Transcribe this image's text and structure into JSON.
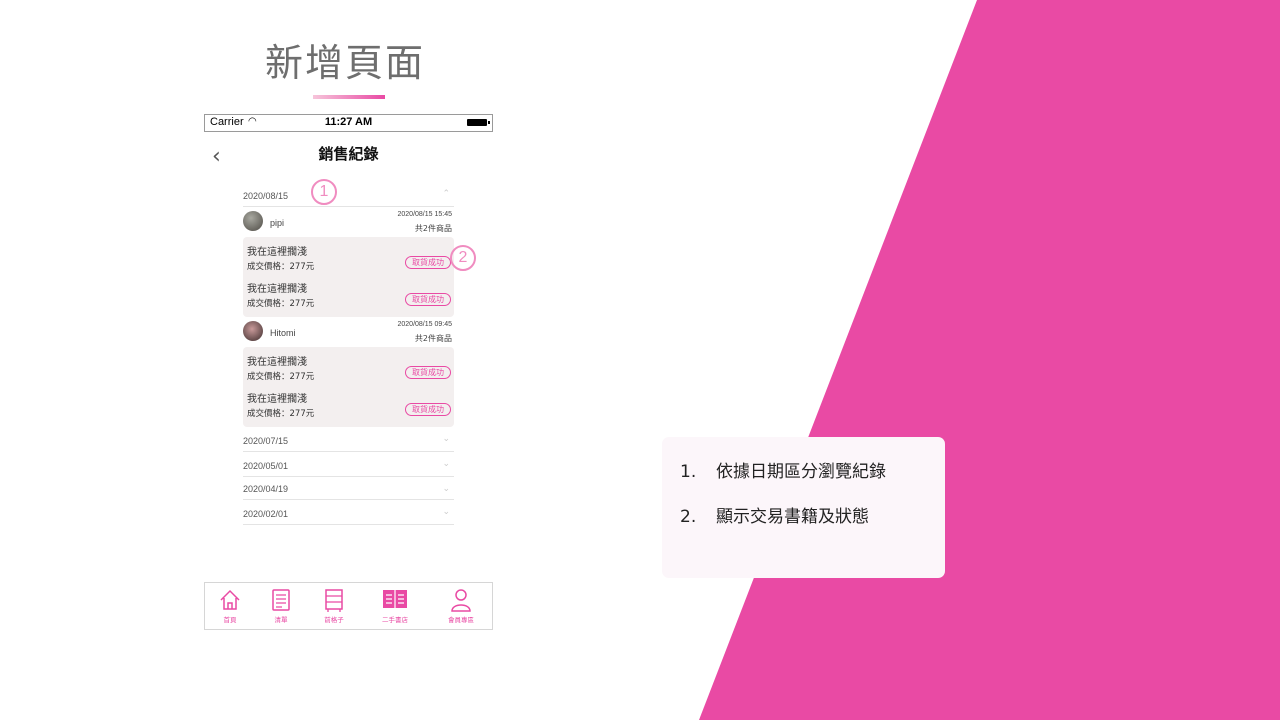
{
  "slide": {
    "title": "新增頁面",
    "accent_color": "#e94aa4"
  },
  "status_bar": {
    "carrier": "Carrier",
    "time": "11:27 AM"
  },
  "nav": {
    "title": "銷售紀錄",
    "back_icon": "chevron-left-icon"
  },
  "markers": [
    "1",
    "2"
  ],
  "sections": [
    {
      "date": "2020/08/15",
      "expanded": true,
      "orders": [
        {
          "user": "pipi",
          "datetime": "2020/08/15 15:45",
          "count": "共2件商品",
          "items": [
            {
              "book": "我在這裡擱淺",
              "price": "成交價格：277元",
              "status": "取貨成功"
            },
            {
              "book": "我在這裡擱淺",
              "price": "成交價格：277元",
              "status": "取貨成功"
            }
          ]
        },
        {
          "user": "Hitomi",
          "datetime": "2020/08/15 09:45",
          "count": "共2件商品",
          "items": [
            {
              "book": "我在這裡擱淺",
              "price": "成交價格：277元",
              "status": "取貨成功"
            },
            {
              "book": "我在這裡擱淺",
              "price": "成交價格：277元",
              "status": "取貨成功"
            }
          ]
        }
      ]
    },
    {
      "date": "2020/07/15",
      "expanded": false
    },
    {
      "date": "2020/05/01",
      "expanded": false
    },
    {
      "date": "2020/04/19",
      "expanded": false
    },
    {
      "date": "2020/02/01",
      "expanded": false
    }
  ],
  "tabbar": [
    {
      "label": "首頁",
      "icon": "home-icon"
    },
    {
      "label": "清單",
      "icon": "checklist-icon"
    },
    {
      "label": "前格子",
      "icon": "shelf-icon"
    },
    {
      "label": "二手書店",
      "icon": "bookstore-icon",
      "active": true
    },
    {
      "label": "會員專區",
      "icon": "user-icon"
    }
  ],
  "notes": [
    {
      "num": "1.",
      "text": "依據日期區分瀏覽紀錄"
    },
    {
      "num": "2.",
      "text": "顯示交易書籍及狀態"
    }
  ]
}
